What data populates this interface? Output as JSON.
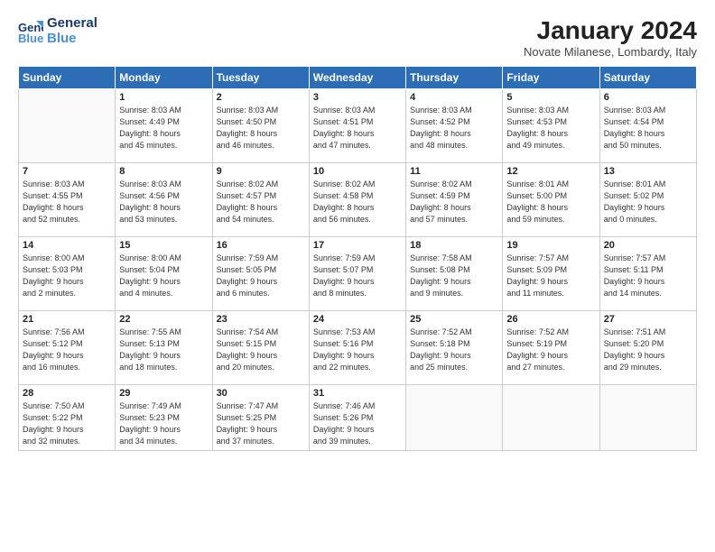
{
  "header": {
    "logo_line1": "General",
    "logo_line2": "Blue",
    "month_title": "January 2024",
    "subtitle": "Novate Milanese, Lombardy, Italy"
  },
  "weekdays": [
    "Sunday",
    "Monday",
    "Tuesday",
    "Wednesday",
    "Thursday",
    "Friday",
    "Saturday"
  ],
  "weeks": [
    [
      {
        "day": "",
        "info": ""
      },
      {
        "day": "1",
        "info": "Sunrise: 8:03 AM\nSunset: 4:49 PM\nDaylight: 8 hours\nand 45 minutes."
      },
      {
        "day": "2",
        "info": "Sunrise: 8:03 AM\nSunset: 4:50 PM\nDaylight: 8 hours\nand 46 minutes."
      },
      {
        "day": "3",
        "info": "Sunrise: 8:03 AM\nSunset: 4:51 PM\nDaylight: 8 hours\nand 47 minutes."
      },
      {
        "day": "4",
        "info": "Sunrise: 8:03 AM\nSunset: 4:52 PM\nDaylight: 8 hours\nand 48 minutes."
      },
      {
        "day": "5",
        "info": "Sunrise: 8:03 AM\nSunset: 4:53 PM\nDaylight: 8 hours\nand 49 minutes."
      },
      {
        "day": "6",
        "info": "Sunrise: 8:03 AM\nSunset: 4:54 PM\nDaylight: 8 hours\nand 50 minutes."
      }
    ],
    [
      {
        "day": "7",
        "info": "Sunrise: 8:03 AM\nSunset: 4:55 PM\nDaylight: 8 hours\nand 52 minutes."
      },
      {
        "day": "8",
        "info": "Sunrise: 8:03 AM\nSunset: 4:56 PM\nDaylight: 8 hours\nand 53 minutes."
      },
      {
        "day": "9",
        "info": "Sunrise: 8:02 AM\nSunset: 4:57 PM\nDaylight: 8 hours\nand 54 minutes."
      },
      {
        "day": "10",
        "info": "Sunrise: 8:02 AM\nSunset: 4:58 PM\nDaylight: 8 hours\nand 56 minutes."
      },
      {
        "day": "11",
        "info": "Sunrise: 8:02 AM\nSunset: 4:59 PM\nDaylight: 8 hours\nand 57 minutes."
      },
      {
        "day": "12",
        "info": "Sunrise: 8:01 AM\nSunset: 5:00 PM\nDaylight: 8 hours\nand 59 minutes."
      },
      {
        "day": "13",
        "info": "Sunrise: 8:01 AM\nSunset: 5:02 PM\nDaylight: 9 hours\nand 0 minutes."
      }
    ],
    [
      {
        "day": "14",
        "info": "Sunrise: 8:00 AM\nSunset: 5:03 PM\nDaylight: 9 hours\nand 2 minutes."
      },
      {
        "day": "15",
        "info": "Sunrise: 8:00 AM\nSunset: 5:04 PM\nDaylight: 9 hours\nand 4 minutes."
      },
      {
        "day": "16",
        "info": "Sunrise: 7:59 AM\nSunset: 5:05 PM\nDaylight: 9 hours\nand 6 minutes."
      },
      {
        "day": "17",
        "info": "Sunrise: 7:59 AM\nSunset: 5:07 PM\nDaylight: 9 hours\nand 8 minutes."
      },
      {
        "day": "18",
        "info": "Sunrise: 7:58 AM\nSunset: 5:08 PM\nDaylight: 9 hours\nand 9 minutes."
      },
      {
        "day": "19",
        "info": "Sunrise: 7:57 AM\nSunset: 5:09 PM\nDaylight: 9 hours\nand 11 minutes."
      },
      {
        "day": "20",
        "info": "Sunrise: 7:57 AM\nSunset: 5:11 PM\nDaylight: 9 hours\nand 14 minutes."
      }
    ],
    [
      {
        "day": "21",
        "info": "Sunrise: 7:56 AM\nSunset: 5:12 PM\nDaylight: 9 hours\nand 16 minutes."
      },
      {
        "day": "22",
        "info": "Sunrise: 7:55 AM\nSunset: 5:13 PM\nDaylight: 9 hours\nand 18 minutes."
      },
      {
        "day": "23",
        "info": "Sunrise: 7:54 AM\nSunset: 5:15 PM\nDaylight: 9 hours\nand 20 minutes."
      },
      {
        "day": "24",
        "info": "Sunrise: 7:53 AM\nSunset: 5:16 PM\nDaylight: 9 hours\nand 22 minutes."
      },
      {
        "day": "25",
        "info": "Sunrise: 7:52 AM\nSunset: 5:18 PM\nDaylight: 9 hours\nand 25 minutes."
      },
      {
        "day": "26",
        "info": "Sunrise: 7:52 AM\nSunset: 5:19 PM\nDaylight: 9 hours\nand 27 minutes."
      },
      {
        "day": "27",
        "info": "Sunrise: 7:51 AM\nSunset: 5:20 PM\nDaylight: 9 hours\nand 29 minutes."
      }
    ],
    [
      {
        "day": "28",
        "info": "Sunrise: 7:50 AM\nSunset: 5:22 PM\nDaylight: 9 hours\nand 32 minutes."
      },
      {
        "day": "29",
        "info": "Sunrise: 7:49 AM\nSunset: 5:23 PM\nDaylight: 9 hours\nand 34 minutes."
      },
      {
        "day": "30",
        "info": "Sunrise: 7:47 AM\nSunset: 5:25 PM\nDaylight: 9 hours\nand 37 minutes."
      },
      {
        "day": "31",
        "info": "Sunrise: 7:46 AM\nSunset: 5:26 PM\nDaylight: 9 hours\nand 39 minutes."
      },
      {
        "day": "",
        "info": ""
      },
      {
        "day": "",
        "info": ""
      },
      {
        "day": "",
        "info": ""
      }
    ]
  ]
}
